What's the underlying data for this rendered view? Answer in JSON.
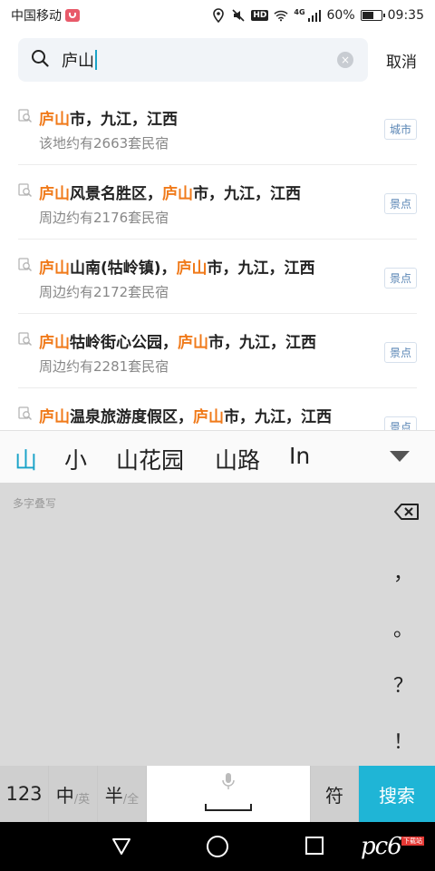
{
  "status_bar": {
    "carrier": "中国移动",
    "network": "4G",
    "hd": "HD",
    "battery_text": "60%",
    "battery_level": 0.6,
    "time": "09:35"
  },
  "search": {
    "query": "庐山",
    "cancel_label": "取消",
    "clear_label": "×"
  },
  "results": [
    {
      "hl": [
        "庐山",
        "",
        ""
      ],
      "parts": [
        "市，九江，江西",
        "",
        ""
      ],
      "sub": "该地约有2663套民宿",
      "tag": "城市"
    },
    {
      "hl": [
        "庐山",
        "庐山",
        ""
      ],
      "parts": [
        "风景名胜区，",
        "市，九江，江西",
        ""
      ],
      "sub": "周边约有2176套民宿",
      "tag": "景点"
    },
    {
      "hl": [
        "庐山",
        "庐山",
        ""
      ],
      "parts": [
        "山南(牯岭镇)，",
        "市，九江，江西",
        ""
      ],
      "sub": "周边约有2172套民宿",
      "tag": "景点"
    },
    {
      "hl": [
        "庐山",
        "庐山",
        ""
      ],
      "parts": [
        "牯岭街心公园，",
        "市，九江，江西",
        ""
      ],
      "sub": "周边约有2281套民宿",
      "tag": "景点"
    },
    {
      "hl": [
        "庐山",
        "庐山",
        ""
      ],
      "parts": [
        "温泉旅游度假区，",
        "市，九江，江西",
        ""
      ],
      "sub": "",
      "tag": "景点"
    }
  ],
  "candidates": [
    "山",
    "小",
    "山花园",
    "山路",
    "In"
  ],
  "keyboard": {
    "handwriting_label": "多字叠写",
    "punctuation": [
      "，",
      "。",
      "？",
      "！"
    ],
    "key_123": "123",
    "key_zh": "中",
    "key_zh_alt": "/英",
    "key_half": "半",
    "key_half_alt": "/全",
    "key_sym": "符",
    "key_search": "搜索"
  },
  "watermark": {
    "text": "pc6",
    "sub": "下载站"
  },
  "colors": {
    "accent": "#1aa3c8",
    "highlight": "#f07a1a",
    "search_key": "#1fb5d6",
    "tag_text": "#5a86b5"
  }
}
